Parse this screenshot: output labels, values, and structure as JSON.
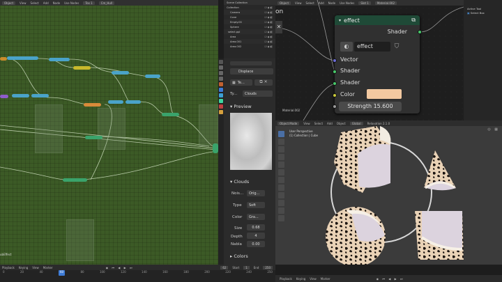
{
  "geometry_editor": {
    "header": [
      "Object",
      "View",
      "Select",
      "Add",
      "Node",
      "Use Nodes",
      "Tex 1",
      "Cm_Hull"
    ],
    "status_text": "ubEffect"
  },
  "outliner": {
    "title": "Scene Collection",
    "items": [
      "Collection",
      "Camera",
      "Cone",
      "Empty.00",
      "Sphere",
      "select.ppl",
      "Area",
      "Area.001",
      "Area.002"
    ]
  },
  "properties": {
    "modifier_name": "Displace",
    "texture_name": "Te...",
    "type_label": "Ty...",
    "type_value": "Clouds",
    "preview_label": "Preview",
    "clouds_label": "Clouds",
    "noise_label": "Nois...",
    "noise_value": "Orig...",
    "type2_label": "Type",
    "type2_value": "Soft",
    "color_label": "Color",
    "color_value": "Gra...",
    "size_label": "Size",
    "size_value": "0.68",
    "depth_label": "Depth",
    "depth_value": "4",
    "nabla_label": "Nabla",
    "nabla_value": "0.00",
    "colors_label": "Colors"
  },
  "shader_editor": {
    "header": [
      "Object",
      "View",
      "Select",
      "Add",
      "Node",
      "Use Nodes",
      "Slot 1",
      "Material.002"
    ],
    "material_label": "Material.002",
    "node_title": "effect",
    "output_label": "Shader",
    "datablock_name": "effect",
    "inputs": [
      "Vector",
      "Shader",
      "Shader",
      "Color"
    ],
    "strength_label": "Strength",
    "strength_value": "15.600",
    "color_swatch": "#f3c9a1",
    "ctx_text": "on",
    "side_panel": {
      "title": "Active Tool",
      "item": "Select Box"
    }
  },
  "viewport": {
    "header": [
      "Object Mode",
      "View",
      "Select",
      "Add",
      "Object",
      "Global",
      "Relaxation 2.1.0"
    ],
    "perspective": "User Perspective",
    "collection": "(1) Collection | Cube"
  },
  "timeline": {
    "labels": [
      "Playback",
      "Keying",
      "View",
      "Marker"
    ],
    "start_label": "Start",
    "start_value": "1",
    "end_label": "End",
    "end_value": "250",
    "current_frame": "62",
    "ticks": [
      "0",
      "20",
      "40",
      "60",
      "80",
      "100",
      "120",
      "140",
      "160",
      "180",
      "200",
      "220",
      "240",
      "250"
    ]
  },
  "bottom_bar": [
    "Playback",
    "Keying",
    "View",
    "Marker"
  ]
}
